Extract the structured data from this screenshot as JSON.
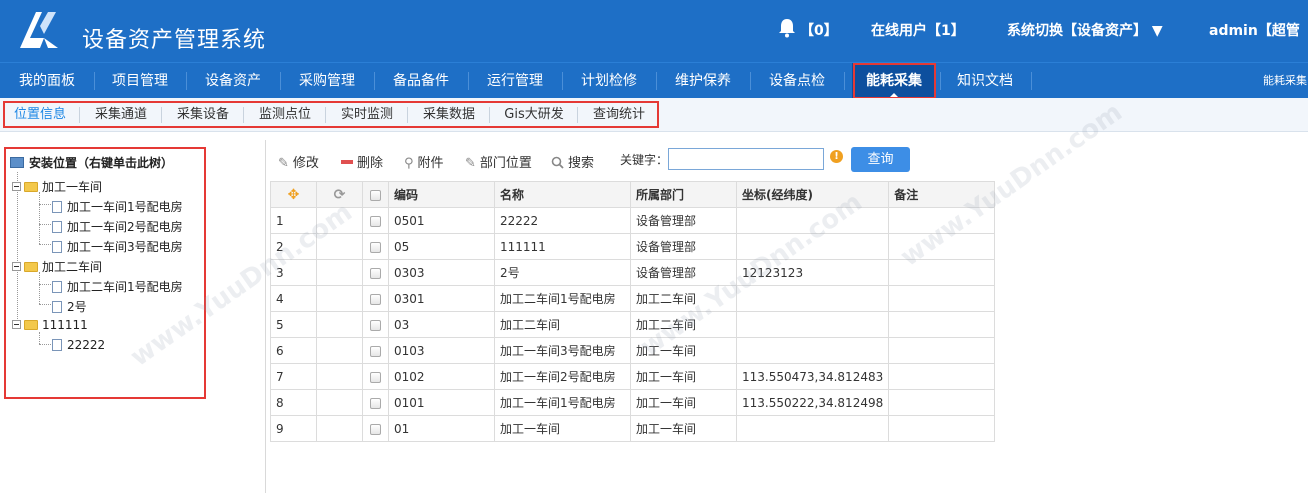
{
  "header": {
    "app_title": "设备资产管理系统",
    "notifications": "【0】",
    "online_users": "在线用户【1】",
    "system_switch": "系统切换【设备资产】 ▼",
    "user": "admin【超管",
    "brand_color": "#1e6fc6"
  },
  "nav": {
    "items": [
      "我的面板",
      "项目管理",
      "设备资产",
      "采购管理",
      "备品备件",
      "运行管理",
      "计划检修",
      "维护保养",
      "设备点检",
      "能耗采集",
      "知识文档"
    ],
    "active": "能耗采集",
    "right_label": "能耗采集"
  },
  "subnav": {
    "items": [
      "位置信息",
      "采集通道",
      "采集设备",
      "监测点位",
      "实时监测",
      "采集数据",
      "Gis大研发",
      "查询统计"
    ],
    "active": "位置信息"
  },
  "tree": {
    "root": "安装位置（右键单击此树）",
    "nodes": [
      {
        "label": "加工一车间",
        "type": "folder"
      },
      {
        "label": "加工一车间1号配电房",
        "type": "file"
      },
      {
        "label": "加工一车间2号配电房",
        "type": "file"
      },
      {
        "label": "加工一车间3号配电房",
        "type": "file"
      },
      {
        "label": "加工二车间",
        "type": "folder"
      },
      {
        "label": "加工二车间1号配电房",
        "type": "file"
      },
      {
        "label": "2号",
        "type": "file"
      },
      {
        "label": "111111",
        "type": "folder"
      },
      {
        "label": "22222",
        "type": "file"
      }
    ]
  },
  "toolbar": {
    "edit": "修改",
    "delete": "删除",
    "attach": "附件",
    "dept_location": "部门位置",
    "search": "搜索",
    "keyword_label": "关键字：",
    "keyword_value": "",
    "query": "查询"
  },
  "table": {
    "headers": [
      "编码",
      "名称",
      "所属部门",
      "坐标(经纬度)",
      "备注"
    ],
    "rows": [
      {
        "n": "1",
        "code": "0501",
        "name": "22222",
        "dept": "设备管理部",
        "coord": "",
        "note": ""
      },
      {
        "n": "2",
        "code": "05",
        "name": "111111",
        "dept": "设备管理部",
        "coord": "",
        "note": ""
      },
      {
        "n": "3",
        "code": "0303",
        "name": "2号",
        "dept": "设备管理部",
        "coord": "12123123",
        "note": ""
      },
      {
        "n": "4",
        "code": "0301",
        "name": "加工二车间1号配电房",
        "dept": "加工二车间",
        "coord": "",
        "note": ""
      },
      {
        "n": "5",
        "code": "03",
        "name": "加工二车间",
        "dept": "加工二车间",
        "coord": "",
        "note": ""
      },
      {
        "n": "6",
        "code": "0103",
        "name": "加工一车间3号配电房",
        "dept": "加工一车间",
        "coord": "",
        "note": ""
      },
      {
        "n": "7",
        "code": "0102",
        "name": "加工一车间2号配电房",
        "dept": "加工一车间",
        "coord": "113.550473,34.812483",
        "note": ""
      },
      {
        "n": "8",
        "code": "0101",
        "name": "加工一车间1号配电房",
        "dept": "加工一车间",
        "coord": "113.550222,34.812498",
        "note": ""
      },
      {
        "n": "9",
        "code": "01",
        "name": "加工一车间",
        "dept": "加工一车间",
        "coord": "",
        "note": ""
      }
    ]
  },
  "watermark": "www.YuuDnn.com"
}
